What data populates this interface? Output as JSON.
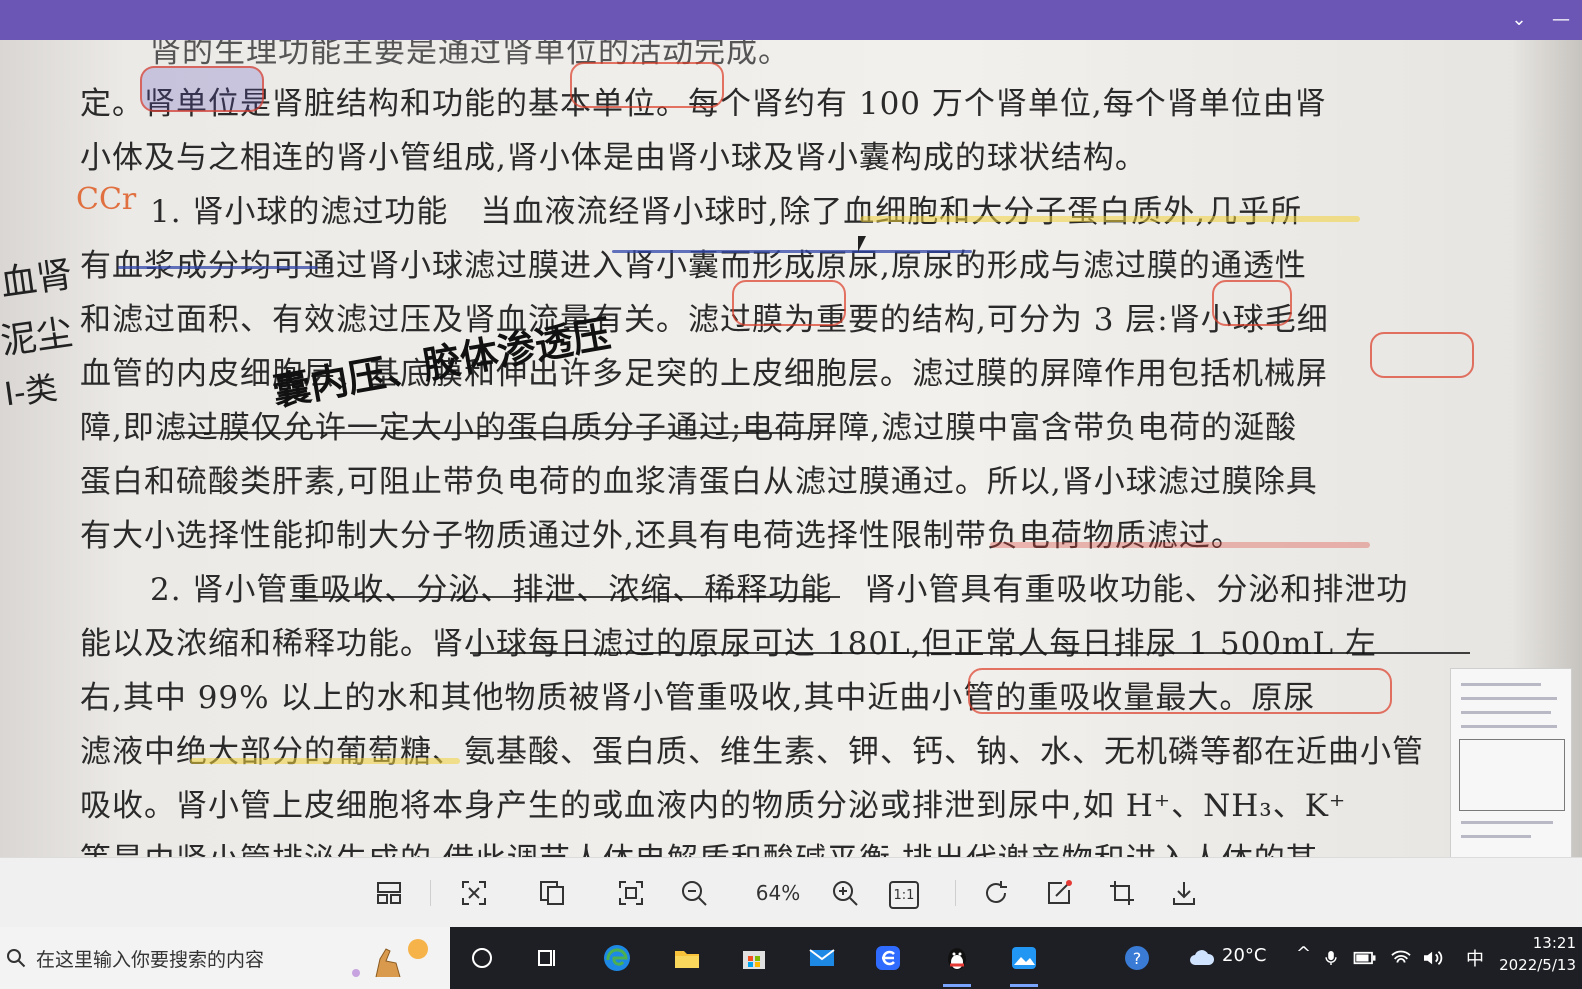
{
  "window": {
    "controls": {
      "chevron": "chevron-down-icon",
      "minimize": "minimize-icon"
    }
  },
  "document": {
    "lines": [
      "肾的生理功能主要是通过肾单位的活动完成。",
      "定。肾单位是肾脏结构和功能的基本单位。每个肾约有 100 万个肾单位,每个肾单位由肾",
      "小体及与之相连的肾小管组成,肾小体是由肾小球及肾小囊构成的球状结构。",
      "1. 肾小球的滤过功能　当血液流经肾小球时,除了血细胞和大分子蛋白质外,几乎所",
      "有血浆成分均可通过肾小球滤过膜进入肾小囊而形成原尿,原尿的形成与滤过膜的通透性",
      "和滤过面积、有效滤过压及肾血流量有关。滤过膜为重要的结构,可分为 3 层:肾小球毛细",
      "血管的内皮细胞层、基底膜和伸出许多足突的上皮细胞层。滤过膜的屏障作用包括机械屏",
      "障,即滤过膜仅允许一定大小的蛋白质分子通过;电荷屏障,滤过膜中富含带负电荷的涎酸",
      "蛋白和硫酸类肝素,可阻止带负电荷的血浆清蛋白从滤过膜通过。所以,肾小球滤过膜除具",
      "有大小选择性能抑制大分子物质通过外,还具有电荷选择性限制带负电荷物质滤过。",
      "2. 肾小管重吸收、分泌、排泄、浓缩、稀释功能　肾小管具有重吸收功能、分泌和排泄功",
      "能以及浓缩和稀释功能。肾小球每日滤过的原尿可达 180L,但正常人每日排尿 1 500mL 左",
      "右,其中 99% 以上的水和其他物质被肾小管重吸收,其中近曲小管的重吸收量最大。原尿",
      "滤液中绝大部分的葡萄糖、氨基酸、蛋白质、维生素、钾、钙、钠、水、无机磷等都在近曲小管",
      "吸收。肾小管上皮细胞将本身产生的或血液内的物质分泌或排泄到尿中,如 H⁺、NH₃、K⁺",
      "等是由肾小管排泌生成的,借此调节人体电解质和酸碱平衡,排出代谢产物和进入人体的某"
    ],
    "handwriting": {
      "margin_ccr": "CCr",
      "left_margin_notes": [
        "血肾",
        "泥尘",
        "I-类"
      ],
      "overwrite": "囊内压、胶体渗透压"
    }
  },
  "toolbar": {
    "zoom": "64%",
    "items": [
      {
        "name": "layout-icon"
      },
      {
        "name": "fit-screen-icon"
      },
      {
        "name": "copy-page-icon"
      },
      {
        "name": "fullscreen-icon"
      },
      {
        "name": "zoom-out-icon"
      },
      {
        "name": "zoom-in-icon"
      },
      {
        "name": "actual-size-icon",
        "label": "1:1"
      },
      {
        "name": "rotate-icon"
      },
      {
        "name": "edit-icon"
      },
      {
        "name": "crop-icon"
      },
      {
        "name": "download-icon"
      }
    ]
  },
  "taskbar": {
    "search_placeholder": "在这里输入你要搜索的内容",
    "weather": "20°C",
    "ime": "中",
    "time": "13:21",
    "date": "2022/5/13"
  },
  "colors": {
    "titlebar": "#6b56b5",
    "taskbar": "#1e1f24",
    "toolbar": "#f0f0f0"
  }
}
